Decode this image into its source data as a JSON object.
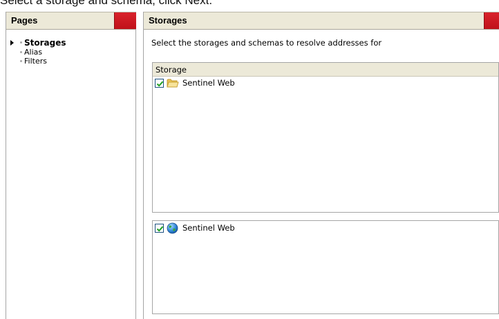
{
  "instruction": {
    "text": "Select a storage and schema, click Next."
  },
  "pages_panel": {
    "title": "Pages",
    "items": [
      {
        "label": "Storages",
        "active": true
      },
      {
        "label": "Alias",
        "active": false
      },
      {
        "label": "Filters",
        "active": false
      }
    ]
  },
  "storages_panel": {
    "title": "Storages",
    "description": "Select the storages and schemas to resolve addresses for",
    "storage_list": {
      "column_header": "Storage",
      "items": [
        {
          "label": "Sentinel Web",
          "checked": true,
          "icon": "folder-icon"
        }
      ]
    },
    "schema_list": {
      "items": [
        {
          "label": "Sentinel Web",
          "checked": true,
          "icon": "globe-icon"
        }
      ]
    }
  },
  "colors": {
    "header_bg": "#ece9d8",
    "header_accent_red": "#c8161e",
    "border": "#a5a5a5",
    "checkbox_check": "#21a121"
  }
}
